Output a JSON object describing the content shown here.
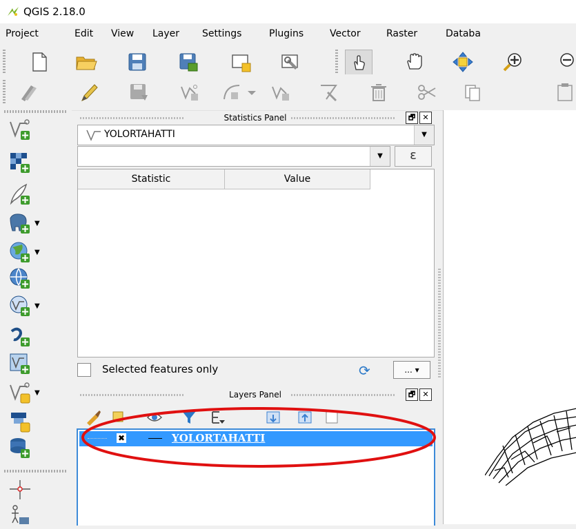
{
  "window": {
    "title": "QGIS 2.18.0"
  },
  "menu": [
    "Project",
    "Edit",
    "View",
    "Layer",
    "Settings",
    "Plugins",
    "Vector",
    "Raster",
    "Databa"
  ],
  "statistics_panel": {
    "title": "Statistics Panel",
    "layer": "YOLORTAHATTI",
    "field": "",
    "expression_label": "ε",
    "columns": [
      "Statistic",
      "Value"
    ],
    "rows": [],
    "selected_only_label": "Selected features only",
    "selected_only_checked": false,
    "more_label": "...",
    "float_label": "🗗",
    "close_label": "✕"
  },
  "layers_panel": {
    "title": "Layers Panel",
    "layers": [
      {
        "name": "YOLORTAHATTI",
        "visible": false,
        "selected": true
      }
    ],
    "float_label": "🗗",
    "close_label": "✕"
  },
  "colors": {
    "selection": "#3399ff",
    "annotation": "#e01010",
    "accent": "#2a78c8"
  }
}
